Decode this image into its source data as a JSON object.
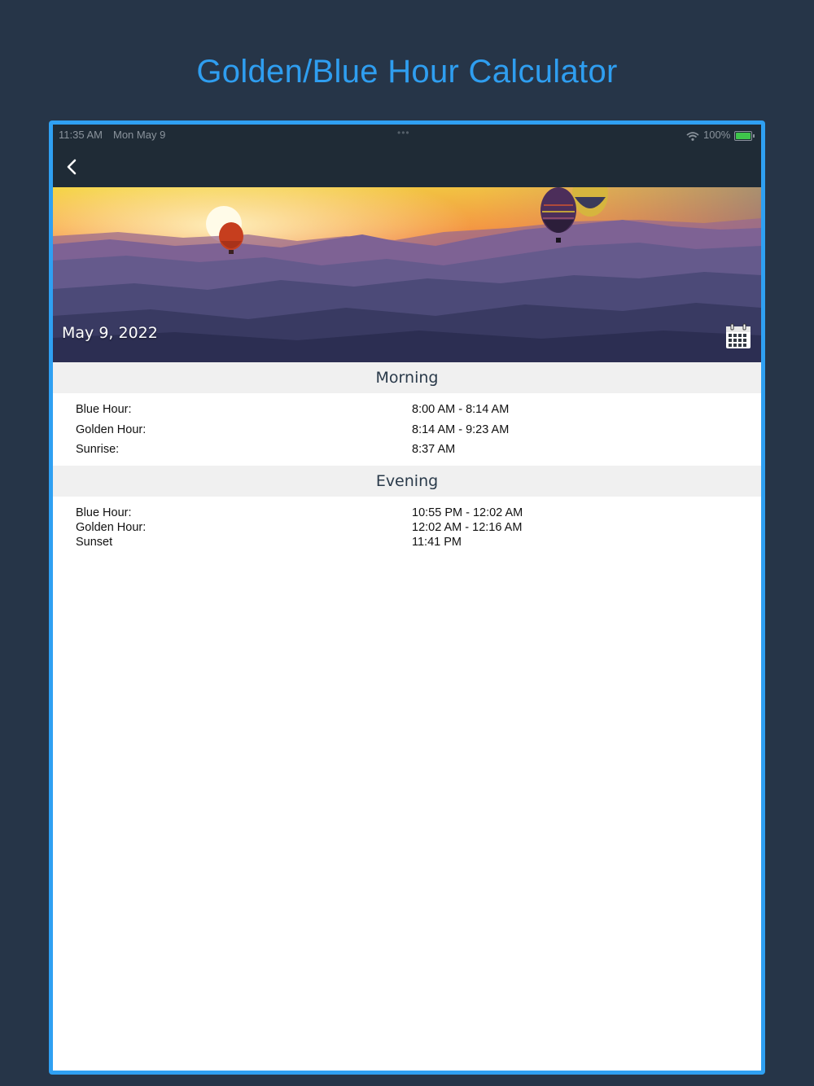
{
  "promo": {
    "title": "Golden/Blue Hour Calculator"
  },
  "status_bar": {
    "time": "11:35 AM",
    "date": "Mon May 9",
    "battery": "100%"
  },
  "hero": {
    "date": "May 9, 2022"
  },
  "morning": {
    "title": "Morning",
    "rows": [
      {
        "label": "Blue Hour:",
        "value": "8:00 AM - 8:14 AM"
      },
      {
        "label": "Golden Hour:",
        "value": "8:14 AM - 9:23 AM"
      },
      {
        "label": "Sunrise:",
        "value": "8:37 AM"
      }
    ]
  },
  "evening": {
    "title": "Evening",
    "rows": [
      {
        "label": "Blue Hour:",
        "value": "10:55 PM - 12:02 AM"
      },
      {
        "label": "Golden Hour:",
        "value": "12:02 AM - 12:16 AM"
      },
      {
        "label": "Sunset",
        "value": "11:41 PM"
      }
    ]
  },
  "icons": {
    "back": "chevron-left-icon",
    "calendar": "calendar-icon",
    "wifi": "wifi-icon",
    "battery": "battery-icon"
  },
  "colors": {
    "page_background": "#263548",
    "accent": "#2f9ef0",
    "nav_background": "#1f2b36",
    "section_background": "#f0f0f0",
    "battery_fill": "#3ec54b"
  }
}
